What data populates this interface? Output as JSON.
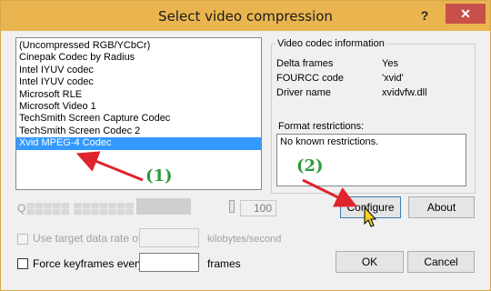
{
  "window": {
    "title": "Select video compression",
    "help_glyph": "?",
    "close_glyph": "✕"
  },
  "codec_list": {
    "items": [
      "(Uncompressed RGB/YCbCr)",
      "Cinepak Codec by Radius",
      "Intel IYUV codec",
      "Intel IYUV codec",
      "Microsoft RLE",
      "Microsoft Video 1",
      "TechSmith Screen Capture Codec",
      "TechSmith Screen Codec 2",
      "Xvid MPEG-4 Codec"
    ],
    "selected": "Xvid MPEG-4 Codec"
  },
  "codec_info": {
    "legend": "Video codec information",
    "rows": [
      {
        "label": "Delta frames",
        "value": "Yes"
      },
      {
        "label": "FOURCC code",
        "value": "'xvid'"
      },
      {
        "label": "Driver name",
        "value": "xvidvfw.dll"
      }
    ],
    "restrictions_label": "Format restrictions:",
    "restrictions_text": "No known restrictions."
  },
  "quality": {
    "value": "100"
  },
  "data_rate": {
    "label": "Use target data rate of",
    "unit": "kilobytes/second"
  },
  "keyframes": {
    "label": "Force keyframes every",
    "unit": "frames",
    "value": ""
  },
  "buttons": {
    "configure": "Configure",
    "about": "About",
    "ok": "OK",
    "cancel": "Cancel"
  },
  "annotations": {
    "step1": "(1)",
    "step2": "(2)"
  },
  "colors": {
    "titlebar": "#eab54f",
    "close_button": "#c7504a",
    "selection": "#3399ff",
    "annotation_text": "#2d9a3a",
    "annotation_arrow": "#e0242c"
  }
}
